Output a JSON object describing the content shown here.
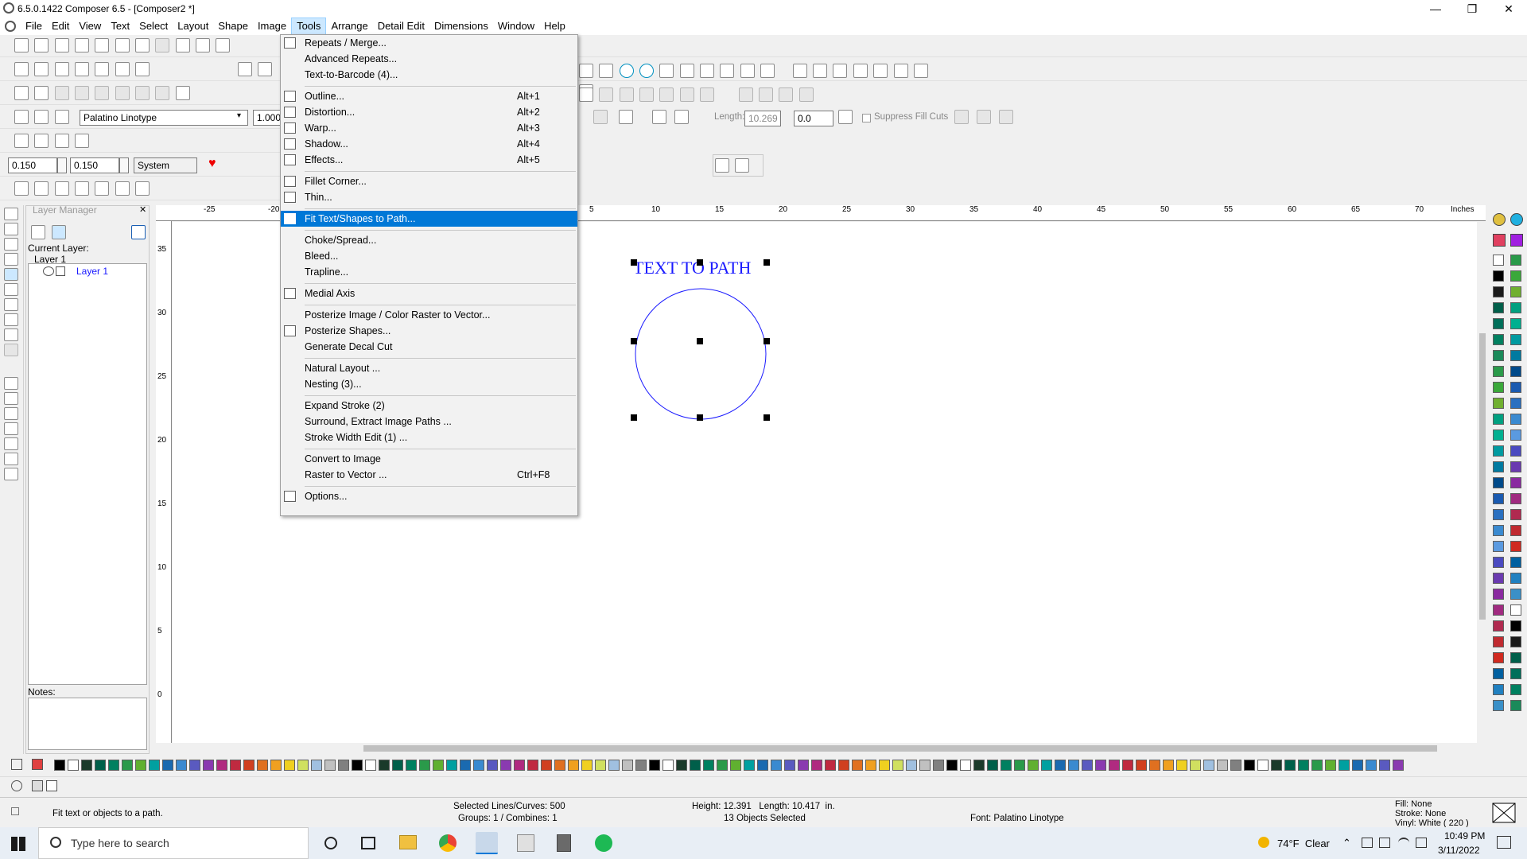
{
  "window": {
    "title": "6.5.0.1422 Composer 6.5 - [Composer2 *]",
    "controls": [
      "—",
      "❐",
      "✕"
    ]
  },
  "menubar": {
    "items": [
      "File",
      "Edit",
      "View",
      "Text",
      "Select",
      "Layout",
      "Shape",
      "Image",
      "Tools",
      "Arrange",
      "Detail Edit",
      "Dimensions",
      "Window",
      "Help"
    ],
    "active": "Tools"
  },
  "text_toolbar": {
    "font": "Palatino Linotype",
    "size": "1.000"
  },
  "stroke_toolbar": {
    "width1": "0.150",
    "width2": "0.150",
    "units": "System"
  },
  "path_toolbar": {
    "length_label": "Length:",
    "length_value": "10.269",
    "offset_value": "0.0",
    "suppress_label": "Suppress Fill Cuts"
  },
  "layer_panel": {
    "title": "Layer Manager",
    "current_layer_label": "Current Layer:",
    "current_layer": "Layer 1",
    "tree_item": "Layer 1",
    "notes_label": "Notes:"
  },
  "ruler": {
    "units": "Inches",
    "h_ticks": [
      "-25",
      "-20",
      "5",
      "10",
      "15",
      "20",
      "25",
      "30",
      "35",
      "40",
      "45",
      "50",
      "55",
      "60",
      "65",
      "70"
    ],
    "v_ticks": [
      "35",
      "30",
      "25",
      "20",
      "15",
      "10",
      "5",
      "0"
    ]
  },
  "canvas": {
    "text_object": "TEXT TO PATH"
  },
  "tools_menu": {
    "items": [
      {
        "label": "Repeats / Merge...",
        "shortcut": "",
        "icon": "repeats-icon"
      },
      {
        "label": "Advanced Repeats...",
        "shortcut": "",
        "icon": ""
      },
      {
        "label": "Text-to-Barcode (4)...",
        "shortcut": "",
        "icon": ""
      },
      {
        "sep": true
      },
      {
        "label": "Outline...",
        "shortcut": "Alt+1",
        "icon": "outline-icon"
      },
      {
        "label": "Distortion...",
        "shortcut": "Alt+2",
        "icon": "distortion-icon"
      },
      {
        "label": "Warp...",
        "shortcut": "Alt+3",
        "icon": "warp-icon"
      },
      {
        "label": "Shadow...",
        "shortcut": "Alt+4",
        "icon": "shadow-icon"
      },
      {
        "label": "Effects...",
        "shortcut": "Alt+5",
        "icon": "effects-icon"
      },
      {
        "sep": true
      },
      {
        "label": "Fillet Corner...",
        "shortcut": "",
        "icon": "fillet-icon"
      },
      {
        "label": "Thin...",
        "shortcut": "",
        "icon": "thin-icon"
      },
      {
        "sep": true
      },
      {
        "label": "Fit Text/Shapes to Path...",
        "shortcut": "",
        "icon": "fit-path-icon",
        "highlight": true
      },
      {
        "sep": true
      },
      {
        "label": "Choke/Spread...",
        "shortcut": "",
        "icon": ""
      },
      {
        "label": "Bleed...",
        "shortcut": "",
        "icon": ""
      },
      {
        "label": "Trapline...",
        "shortcut": "",
        "icon": ""
      },
      {
        "sep": true
      },
      {
        "label": "Medial Axis",
        "shortcut": "",
        "icon": "medial-axis-icon"
      },
      {
        "sep": true
      },
      {
        "label": "Posterize Image / Color Raster to Vector...",
        "shortcut": "",
        "icon": ""
      },
      {
        "label": "Posterize Shapes...",
        "shortcut": "",
        "icon": "posterize-icon"
      },
      {
        "label": "Generate Decal Cut",
        "shortcut": "",
        "icon": ""
      },
      {
        "sep": true
      },
      {
        "label": "Natural Layout ...",
        "shortcut": "",
        "icon": ""
      },
      {
        "label": "Nesting (3)...",
        "shortcut": "",
        "icon": ""
      },
      {
        "sep": true
      },
      {
        "label": "Expand Stroke (2)",
        "shortcut": "",
        "icon": ""
      },
      {
        "label": "Surround, Extract Image Paths ...",
        "shortcut": "",
        "icon": ""
      },
      {
        "label": "Stroke Width Edit (1) ...",
        "shortcut": "",
        "icon": ""
      },
      {
        "sep": true
      },
      {
        "label": "Convert to Image",
        "shortcut": "",
        "icon": ""
      },
      {
        "label": "Raster to Vector ...",
        "shortcut": "Ctrl+F8",
        "icon": ""
      },
      {
        "sep": true
      },
      {
        "label": "Options...",
        "shortcut": "",
        "icon": "options-icon"
      }
    ]
  },
  "status": {
    "hint": "Fit text or objects to a path.",
    "selected": "Selected Lines/Curves: 500",
    "groups": "Groups: 1 / Combines: 1",
    "dims": "Height: 12.391   Length: 10.417  in.",
    "objects": "13 Objects Selected",
    "font": "Font: Palatino Linotype",
    "fill": "Fill: None",
    "stroke": "Stroke: None",
    "vinyl": "Vinyl: White ( 220 )"
  },
  "taskbar": {
    "search_placeholder": "Type here to search",
    "weather": "74°F  Clear",
    "time": "10:49 PM",
    "date": "3/11/2022"
  },
  "colors": {
    "accent": "#0078d7",
    "object": "#1a1aff"
  }
}
